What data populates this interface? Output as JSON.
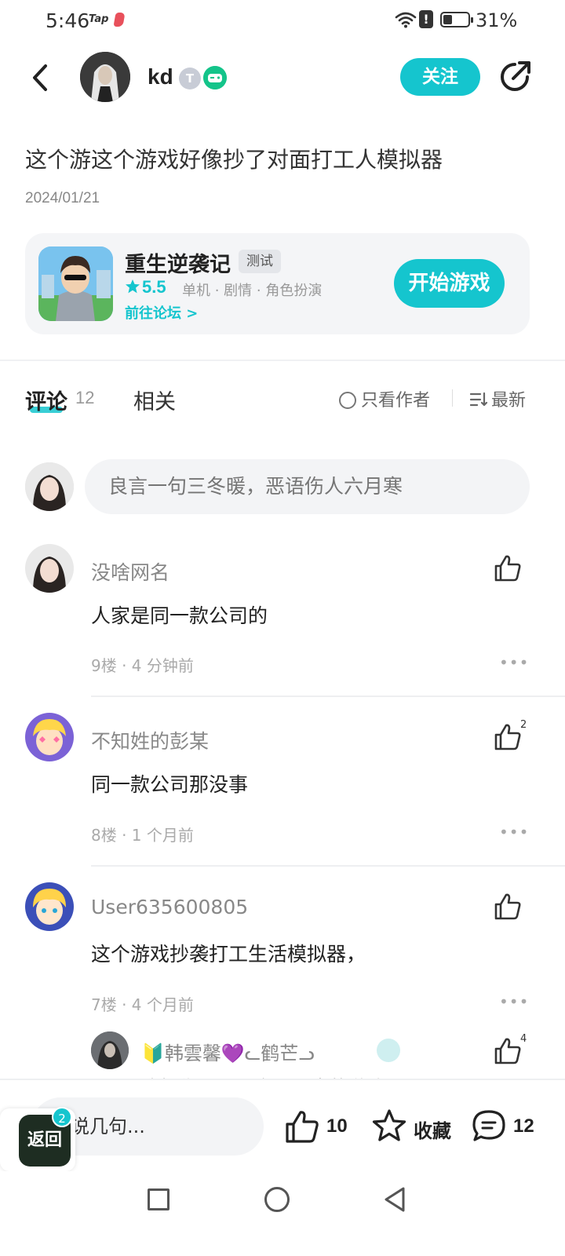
{
  "status_bar": {
    "time": "5:46",
    "app_tag": "Tap",
    "battery": "31%"
  },
  "header": {
    "author_name": "kd",
    "badge_level": "T",
    "follow_label": "关注"
  },
  "post": {
    "title": "这个游这个游戏好像抄了对面打工人模拟器",
    "date": "2024/01/21"
  },
  "game_card": {
    "name": "重生逆袭记",
    "tag": "测试",
    "rating": "5.5",
    "tags_text": "单机 · 剧情 · 角色扮演",
    "forum_link": "前往论坛 >",
    "start_label": "开始游戏"
  },
  "tabs": {
    "comments_label": "评论",
    "comments_count": "12",
    "related_label": "相关",
    "only_author_label": "只看作者",
    "sort_label": "最新"
  },
  "comment_input": {
    "placeholder": "良言一句三冬暖，恶语伤人六月寒"
  },
  "comments": [
    {
      "name": "没啥网名",
      "text": "人家是同一款公司的",
      "meta": "9楼 · 4 分钟前",
      "likes": ""
    },
    {
      "name": "不知姓的彭某",
      "text": "同一款公司那没事",
      "meta": "8楼 · 1 个月前",
      "likes": "2"
    },
    {
      "name": "User635600805",
      "text": "这个游戏抄袭打工生活模拟器，",
      "meta": "7楼 · 4 个月前",
      "likes": ""
    }
  ],
  "reply": {
    "name": "🔰韩雲馨💜ᓚ鹤芒ᓗ",
    "text": "这好像是同一家公司出的游戏",
    "likes": "4"
  },
  "more_glyph": "•••",
  "bottom_bar": {
    "say_placeholder": "说几句...",
    "back_label": "返回",
    "back_badge": "2",
    "like_count": "10",
    "favorite_label": "收藏",
    "comment_count": "12"
  }
}
